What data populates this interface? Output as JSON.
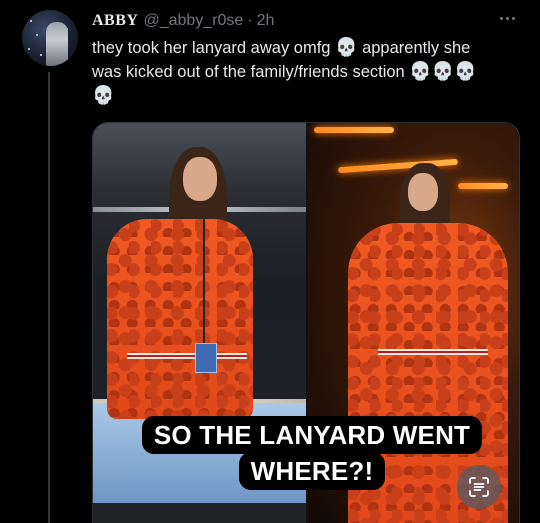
{
  "tweet": {
    "display_name": "ABBY",
    "handle": "@_abby_r0se",
    "separator": "·",
    "time": "2h",
    "text_line1": "they took her lanyard away omfg",
    "text_line1b": "apparently she",
    "text_line2": "was kicked out of the family/friends section",
    "emoji": "💀"
  },
  "media": {
    "caption_line1": "SO THE LANYARD WENT",
    "caption_line2": "WHERE?!"
  },
  "icons": {
    "more": "more-horizontal-icon",
    "live_text": "live-text-icon",
    "skull": "skull-emoji"
  },
  "colors": {
    "background": "#000000",
    "text": "#e7e9ea",
    "muted": "#71767b",
    "jacket": "#f05a22"
  }
}
